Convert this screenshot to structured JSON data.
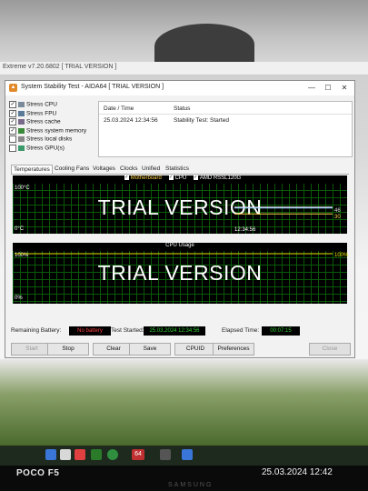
{
  "background_window": {
    "title": "Extreme v7.20.6802   [ TRIAL VERSION ]"
  },
  "window": {
    "title": "System Stability Test - AIDA64  [ TRIAL VERSION ]",
    "controls": {
      "minimize": "—",
      "maximize": "☐",
      "close": "✕"
    }
  },
  "stress_options": [
    {
      "label": "Stress CPU",
      "checked": true
    },
    {
      "label": "Stress FPU",
      "checked": true
    },
    {
      "label": "Stress cache",
      "checked": true
    },
    {
      "label": "Stress system memory",
      "checked": true
    },
    {
      "label": "Stress local disks",
      "checked": false
    },
    {
      "label": "Stress GPU(s)",
      "checked": false
    }
  ],
  "status_table": {
    "col_datetime": "Date / Time",
    "col_status": "Status",
    "row_datetime": "25.03.2024 12:34:56",
    "row_status": "Stability Test: Started"
  },
  "tabs": [
    "Temperatures",
    "Cooling Fans",
    "Voltages",
    "Clocks",
    "Unified",
    "Statistics"
  ],
  "temperature_graph": {
    "legend": [
      "Motherboard",
      "CPU",
      "AMD RSSL120G"
    ],
    "y_top": "100°C",
    "y_bottom": "0°C",
    "time_label": "12:34:56",
    "watermark": "TRIAL VERSION",
    "value_1": "46",
    "value_2": "30"
  },
  "cpu_graph": {
    "title": "CPU Usage",
    "y_top": "100%",
    "y_bottom": "0%",
    "watermark": "TRIAL VERSION",
    "value": "100%"
  },
  "status_bar": {
    "battery_label": "Remaining Battery:",
    "battery_value": "No battery",
    "started_label": "Test Started:",
    "started_value": "25.03.2024 12:34:56",
    "elapsed_label": "Elapsed Time:",
    "elapsed_value": "00:07:15"
  },
  "buttons": {
    "start": "Start",
    "stop": "Stop",
    "clear": "Clear",
    "save": "Save",
    "cpuid": "CPUID",
    "preferences": "Preferences",
    "close": "Close"
  },
  "taskbar": {
    "icon_64": "64"
  },
  "photo_overlay": {
    "phone_model": "POCO F5",
    "timestamp": "25.03.2024 12:42",
    "monitor_brand": "SAMSUNG"
  },
  "chart_data": [
    {
      "type": "line",
      "title": "",
      "series": [
        {
          "name": "Motherboard",
          "values": [
            30,
            30
          ]
        },
        {
          "name": "CPU",
          "values": [
            46,
            46
          ]
        },
        {
          "name": "AMD RSSL120G",
          "values": [
            44,
            44
          ]
        }
      ],
      "ylim": [
        0,
        100
      ],
      "ylabel": "",
      "x_tick_labels": [
        "12:34:56"
      ]
    },
    {
      "type": "line",
      "title": "CPU Usage",
      "series": [
        {
          "values": [
            100,
            100
          ]
        }
      ],
      "ylim": [
        0,
        100
      ]
    }
  ],
  "colors": {
    "graph_bg": "#000000",
    "grid": "#0a5a0a",
    "cpu_line": "#e6e600",
    "field_green": "#35d135",
    "field_red": "#ff4040"
  }
}
